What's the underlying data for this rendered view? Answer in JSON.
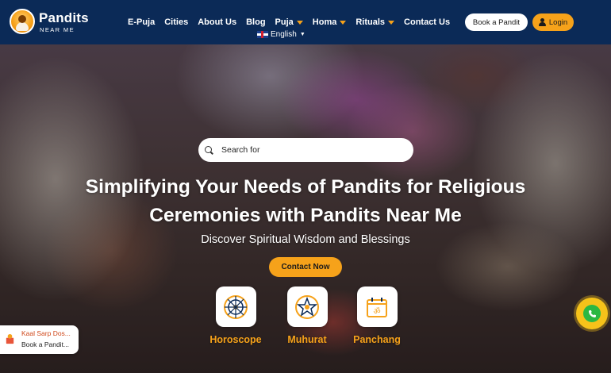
{
  "brand": {
    "name": "Pandits",
    "tagline": "NEAR ME"
  },
  "nav": {
    "items": [
      {
        "label": "E-Puja",
        "dropdown": false
      },
      {
        "label": "Cities",
        "dropdown": false
      },
      {
        "label": "About Us",
        "dropdown": false
      },
      {
        "label": "Blog",
        "dropdown": false
      },
      {
        "label": "Puja",
        "dropdown": true
      },
      {
        "label": "Homa",
        "dropdown": true
      },
      {
        "label": "Rituals",
        "dropdown": true
      },
      {
        "label": "Contact Us",
        "dropdown": false
      }
    ],
    "language": "English",
    "book_button": "Book a Pandit",
    "login_button": "Login"
  },
  "hero": {
    "search_placeholder": "Search for",
    "title_line1": "Simplifying Your Needs of Pandits for Religious",
    "title_line2": "Ceremonies with Pandits Near Me",
    "subtitle": "Discover Spiritual Wisdom and Blessings",
    "cta": "Contact Now",
    "features": [
      {
        "label": "Horoscope",
        "icon": "horoscope-wheel-icon"
      },
      {
        "label": "Muhurat",
        "icon": "muhurat-star-icon"
      },
      {
        "label": "Panchang",
        "icon": "panchang-calendar-icon"
      }
    ]
  },
  "promo": {
    "line1": "Kaal Sarp Dos...",
    "line2": "Book a Pandit..."
  },
  "colors": {
    "navbar": "#0b2a57",
    "accent": "#f6a21a",
    "whatsapp": "#2cb742"
  }
}
